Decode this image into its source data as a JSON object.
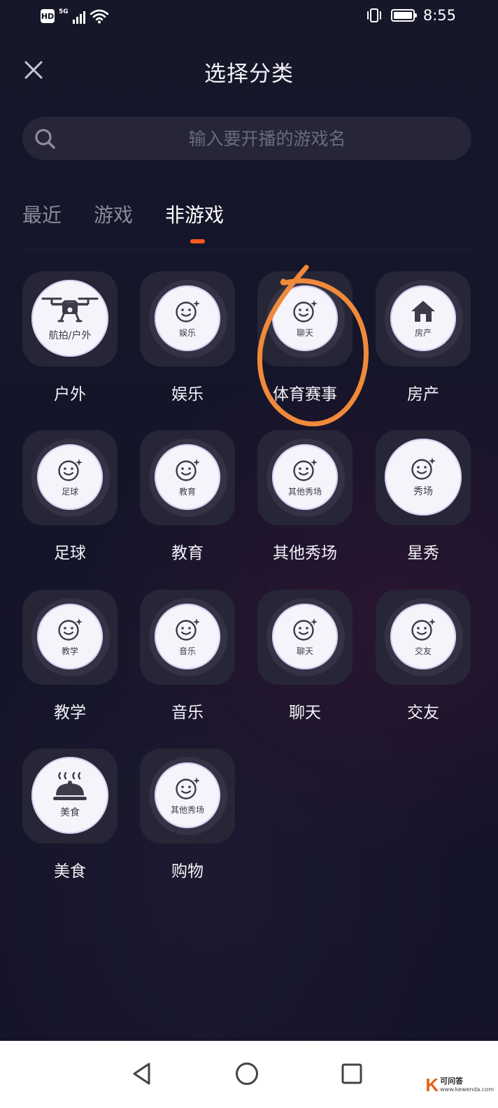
{
  "status_bar": {
    "hd": "HD",
    "network": "5G",
    "time": "8:55"
  },
  "header": {
    "title": "选择分类"
  },
  "search": {
    "placeholder": "输入要开播的游戏名"
  },
  "tabs": [
    {
      "label": "最近",
      "active": false
    },
    {
      "label": "游戏",
      "active": false
    },
    {
      "label": "非游戏",
      "active": true
    }
  ],
  "categories": [
    {
      "caption": "户外",
      "badge": "航拍/户外",
      "icon": "drone-icon"
    },
    {
      "caption": "娱乐",
      "badge": "娱乐",
      "icon": "smiley-icon"
    },
    {
      "caption": "体育赛事",
      "badge": "聊天",
      "icon": "smiley-icon"
    },
    {
      "caption": "房产",
      "badge": "房产",
      "icon": "house-icon"
    },
    {
      "caption": "足球",
      "badge": "足球",
      "icon": "smiley-icon"
    },
    {
      "caption": "教育",
      "badge": "教育",
      "icon": "smiley-icon"
    },
    {
      "caption": "其他秀场",
      "badge": "其他秀场",
      "icon": "smiley-icon"
    },
    {
      "caption": "星秀",
      "badge": "秀场",
      "icon": "smiley-icon"
    },
    {
      "caption": "教学",
      "badge": "教学",
      "icon": "smiley-icon"
    },
    {
      "caption": "音乐",
      "badge": "音乐",
      "icon": "smiley-icon"
    },
    {
      "caption": "聊天",
      "badge": "聊天",
      "icon": "smiley-icon"
    },
    {
      "caption": "交友",
      "badge": "交友",
      "icon": "smiley-icon"
    },
    {
      "caption": "美食",
      "badge": "美食",
      "icon": "cloche-icon"
    },
    {
      "caption": "购物",
      "badge": "其他秀场",
      "icon": "smiley-icon"
    }
  ],
  "colors": {
    "accent": "#ff5b1e",
    "annotation": "#f08a3a",
    "background": "#15152a"
  },
  "watermark": {
    "logo": "K",
    "site_name": "可问答",
    "url": "www.kewenda.com"
  }
}
